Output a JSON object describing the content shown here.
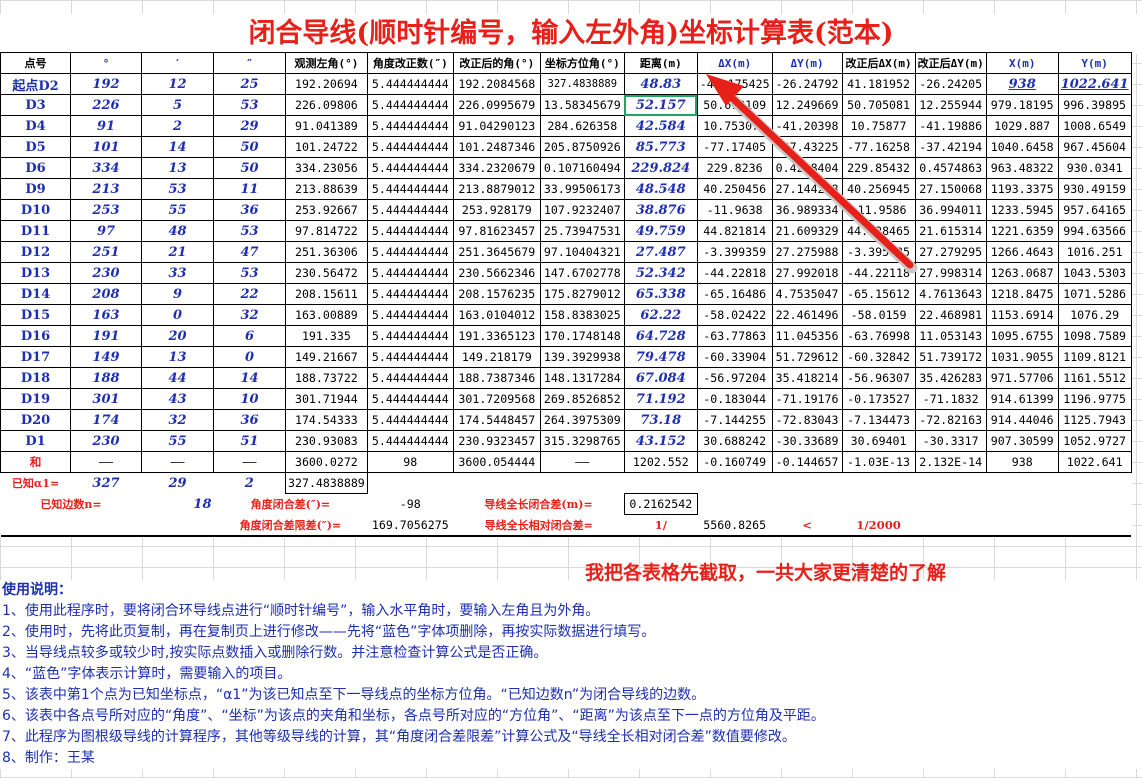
{
  "title": "闭合导线(顺时针编号，输入左外角)坐标计算表(范本)",
  "headers": [
    "点号",
    "°",
    "′",
    "″",
    "观测左角(°)",
    "角度改正数(″)",
    "改正后的角(°)",
    "坐标方位角(°)",
    "距离(m)",
    "ΔX(m)",
    "ΔY(m)",
    "改正后ΔX(m)",
    "改正后ΔY(m)",
    "X(m)",
    "Y(m)"
  ],
  "rows": [
    [
      "起点D2",
      "192",
      "12",
      "25",
      "192.20694",
      "5.444444444",
      "192.2084568",
      "327.4838889",
      "48.83",
      "-41.175425",
      "-26.24792",
      "41.181952",
      "-26.24205",
      "938",
      "1022.641"
    ],
    [
      "D3",
      "226",
      "5",
      "53",
      "226.09806",
      "5.444444444",
      "226.0995679",
      "13.58345679",
      "52.157",
      "50.678109",
      "12.249669",
      "50.705081",
      "12.255944",
      "979.18195",
      "996.39895"
    ],
    [
      "D4",
      "91",
      "2",
      "29",
      "91.041389",
      "5.444444444",
      "91.04290123",
      "284.626358",
      "42.584",
      "10.753078",
      "-41.20398",
      "10.75877",
      "-41.19886",
      "1029.887",
      "1008.6549"
    ],
    [
      "D5",
      "101",
      "14",
      "50",
      "101.24722",
      "5.444444444",
      "101.2487346",
      "205.8750926",
      "85.773",
      "-77.17405",
      "-37.43225",
      "-77.16258",
      "-37.42194",
      "1040.6458",
      "967.45604"
    ],
    [
      "D6",
      "334",
      "13",
      "50",
      "334.23056",
      "5.444444444",
      "334.2320679",
      "0.107160494",
      "229.824",
      "229.8236",
      "0.4298404",
      "229.85432",
      "0.4574863",
      "963.48322",
      "930.0341"
    ],
    [
      "D9",
      "213",
      "53",
      "11",
      "213.88639",
      "5.444444444",
      "213.8879012",
      "33.99506173",
      "48.548",
      "40.250456",
      "27.144238",
      "40.256945",
      "27.150068",
      "1193.3375",
      "930.49159"
    ],
    [
      "D10",
      "253",
      "55",
      "36",
      "253.92667",
      "5.444444444",
      "253.928179",
      "107.9232407",
      "38.876",
      "-11.9638",
      "36.989334",
      "-11.9586",
      "36.994011",
      "1233.5945",
      "957.64165"
    ],
    [
      "D11",
      "97",
      "48",
      "53",
      "97.814722",
      "5.444444444",
      "97.81623457",
      "25.73947531",
      "49.759",
      "44.821814",
      "21.609329",
      "44.828465",
      "21.615314",
      "1221.6359",
      "994.63566"
    ],
    [
      "D12",
      "251",
      "21",
      "47",
      "251.36306",
      "5.444444444",
      "251.3645679",
      "97.10404321",
      "27.487",
      "-3.399359",
      "27.275988",
      "-3.395685",
      "27.279295",
      "1266.4643",
      "1016.251"
    ],
    [
      "D13",
      "230",
      "33",
      "53",
      "230.56472",
      "5.444444444",
      "230.5662346",
      "147.6702778",
      "52.342",
      "-44.22818",
      "27.992018",
      "-44.22118",
      "27.998314",
      "1263.0687",
      "1043.5303"
    ],
    [
      "D14",
      "208",
      "9",
      "22",
      "208.15611",
      "5.444444444",
      "208.1576235",
      "175.8279012",
      "65.338",
      "-65.16486",
      "4.7535047",
      "-65.15612",
      "4.7613643",
      "1218.8475",
      "1071.5286"
    ],
    [
      "D15",
      "163",
      "0",
      "32",
      "163.00889",
      "5.444444444",
      "163.0104012",
      "158.8383025",
      "62.22",
      "-58.02422",
      "22.461496",
      "-58.0159",
      "22.468981",
      "1153.6914",
      "1076.29"
    ],
    [
      "D16",
      "191",
      "20",
      "6",
      "191.335",
      "5.444444444",
      "191.3365123",
      "170.1748148",
      "64.728",
      "-63.77863",
      "11.045356",
      "-63.76998",
      "11.053143",
      "1095.6755",
      "1098.7589"
    ],
    [
      "D17",
      "149",
      "13",
      "0",
      "149.21667",
      "5.444444444",
      "149.218179",
      "139.3929938",
      "79.478",
      "-60.33904",
      "51.729612",
      "-60.32842",
      "51.739172",
      "1031.9055",
      "1109.8121"
    ],
    [
      "D18",
      "188",
      "44",
      "14",
      "188.73722",
      "5.444444444",
      "188.7387346",
      "148.1317284",
      "67.084",
      "-56.97204",
      "35.418214",
      "-56.96307",
      "35.426283",
      "971.57706",
      "1161.5512"
    ],
    [
      "D19",
      "301",
      "43",
      "10",
      "301.71944",
      "5.444444444",
      "301.7209568",
      "269.8526852",
      "71.192",
      "-0.183044",
      "-71.19176",
      "-0.173527",
      "-71.1832",
      "914.61399",
      "1196.9775"
    ],
    [
      "D20",
      "174",
      "32",
      "36",
      "174.54333",
      "5.444444444",
      "174.5448457",
      "264.3975309",
      "73.18",
      "-7.144255",
      "-72.83043",
      "-7.134473",
      "-72.82163",
      "914.44046",
      "1125.7943"
    ],
    [
      "D1",
      "230",
      "55",
      "51",
      "230.93083",
      "5.444444444",
      "230.9323457",
      "315.3298765",
      "43.152",
      "30.688242",
      "-30.33689",
      "30.69401",
      "-30.3317",
      "907.30599",
      "1052.9727"
    ]
  ],
  "sum_row": [
    "和",
    "——",
    "——",
    "——",
    "3600.0272",
    "98",
    "3600.054444",
    "——",
    "1202.552",
    "-0.160749",
    "-0.144657",
    "-1.03E-13",
    "2.132E-14",
    "938",
    "1022.641"
  ],
  "known": {
    "alpha_label": "已知α1=",
    "alpha_deg": "327",
    "alpha_min": "29",
    "alpha_sec": "2",
    "alpha_value": "327.4838889",
    "n_label": "已知边数n=",
    "n_value": "18",
    "angle_err_label": "角度闭合差(″)=",
    "angle_err_value": "-98",
    "total_err_label": "导线全长闭合差(m)=",
    "total_err_value": "0.2162542",
    "angle_limit_label": "角度闭合差限差(″)=",
    "angle_limit_value": "169.7056275",
    "rel_err_label": "导线全长相对闭合差=",
    "rel_err_num": "1/",
    "rel_err_denom": "5560.8265",
    "rel_err_lt": "<",
    "rel_err_limit": "1/2000"
  },
  "callout": "我把各表格先截取，一共大家更清楚的了解",
  "instructions": {
    "heading": "使用说明：",
    "lines": [
      "1、使用此程序时，要将闭合环导线点进行“顺时针编号”，输入水平角时，要输入左角且为外角。",
      "2、使用时，先将此页复制，再在复制页上进行修改——先将“蓝色”字体项删除，再按实际数据进行填写。",
      "3、当导线点较多或较少时,按实际点数插入或删除行数。并注意检查计算公式是否正确。",
      "4、“蓝色”字体表示计算时，需要输入的项目。",
      "5、该表中第1个点为已知坐标点，“α1”为该已知点至下一导线点的坐标方位角。“已知边数n”为闭合导线的边数。",
      "6、该表中各点号所对应的“角度”、“坐标”为该点的夹角和坐标，各点号所对应的“方位角”、“距离”为该点至下一点的方位角及平距。",
      "7、此程序为图根级导线的计算程序，其他等级导线的计算，其“角度闭合差限差”计算公式及“导线全长相对闭合差”数值要修改。",
      "8、制作：王某"
    ]
  },
  "colors": {
    "title_red": "#e8201a",
    "input_blue": "#1d2fb0",
    "selection_green": "#21a366",
    "grid": "#d9d9d9"
  }
}
